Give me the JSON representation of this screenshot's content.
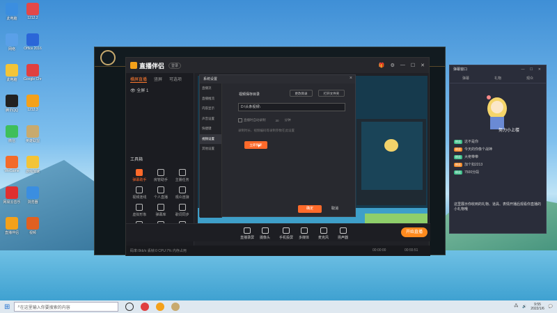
{
  "desktop": {
    "icons": [
      {
        "label": "此电脑",
        "color": "#3b8ee0"
      },
      {
        "label": "1212.2",
        "color": "#e34848"
      },
      {
        "label": "网络",
        "color": "#5aa0e8"
      },
      {
        "label": "Office 2016",
        "color": "#2b66d8"
      },
      {
        "label": "此电脑",
        "color": "#f3c437"
      },
      {
        "label": "Google Chrome",
        "color": "#e04040"
      },
      {
        "label": "腾讯QQ",
        "color": "#222222"
      },
      {
        "label": "1212.3",
        "color": "#f4a11a"
      },
      {
        "label": "微信",
        "color": "#3fbf5a"
      },
      {
        "label": "英雄联盟",
        "color": "#c8aa6e"
      },
      {
        "label": "WeGame",
        "color": "#f36b2a"
      },
      {
        "label": "游戏加速",
        "color": "#f3c437"
      },
      {
        "label": "网易云音乐",
        "color": "#e03030"
      },
      {
        "label": "浏览器",
        "color": "#3b8ee0"
      },
      {
        "label": "直播伴侣",
        "color": "#f4a11a"
      },
      {
        "label": "视频",
        "color": "#e06020"
      }
    ]
  },
  "taskbar": {
    "search_placeholder": "在这里输入你要搜索的内容",
    "time": "9:55",
    "date": "2022/1/6"
  },
  "app": {
    "name": "直播伴侣",
    "login": "登录",
    "tabs": [
      "横屏直播",
      "竖屏",
      "可选项"
    ],
    "scene": "全屏 1",
    "tools_title": "工具箱",
    "tools": [
      {
        "label": "弹幕助手",
        "active": true
      },
      {
        "label": "房管助手",
        "active": false
      },
      {
        "label": "主播任务",
        "active": false
      },
      {
        "label": "视频连线",
        "active": false
      },
      {
        "label": "个人直播",
        "active": false
      },
      {
        "label": "观众连接",
        "active": false
      },
      {
        "label": "虚拟形象",
        "active": false
      },
      {
        "label": "弹幕库",
        "active": false
      },
      {
        "label": "歌词同步",
        "active": false
      },
      {
        "label": "更多",
        "active": false
      },
      {
        "label": "工具",
        "active": false
      },
      {
        "label": "设置",
        "active": false
      }
    ],
    "controls": [
      {
        "label": "直播录屏"
      },
      {
        "label": "摄像头"
      },
      {
        "label": "手机投屏"
      },
      {
        "label": "多媒体"
      },
      {
        "label": "麦克风"
      },
      {
        "label": "扬声器"
      }
    ],
    "go_live": "开始直播",
    "status_left": "码率:0kb/s  丢帧:0  CPU:7%  内存占用",
    "status_right_1": "00:00:00",
    "status_right_2": "00:55:51"
  },
  "settings": {
    "title": "系统设置",
    "nav": [
      "直播流",
      "直播推流",
      "内容显示",
      "声音设置",
      "快捷键",
      "视频设置",
      "其他设置"
    ],
    "selected_nav": 5,
    "save_dir_label": "视频保存目录",
    "change_dir_btn": "更改目录",
    "open_folder_btn": "打开文件夹",
    "path_value": "D:\\头条视频\\",
    "check_label": "直播时自动录制",
    "split_value": "30",
    "split_unit": "分钟",
    "hint": "录制时长、视频编码等录制参数在此设置",
    "apply_btn": "立即保存",
    "ok_btn": "确定",
    "cancel_btn": "取消"
  },
  "chat": {
    "title": "弹幕窗口",
    "tabs": [
      "弹幕",
      "礼物",
      "观众"
    ],
    "avatar_caption": "努力小上楼",
    "messages": [
      {
        "tag": "粉丝",
        "name": "",
        "text": "这不是你"
      },
      {
        "tag": "粉丝",
        "name": "",
        "text": "今天的你像个战神"
      },
      {
        "tag": "粉丝",
        "name": "",
        "text": "大佬带带"
      },
      {
        "tag": "粉丝",
        "name": "",
        "text": "加个扣2213"
      },
      {
        "tag": "粉丝",
        "name": "",
        "text": "7500分段"
      }
    ],
    "footer": "这里展示你收到的礼物、道具、表情开播后观看你直播的小礼物哦"
  },
  "colors": {
    "accent": "#ff6a2a",
    "gold": "#c8aa6e"
  }
}
